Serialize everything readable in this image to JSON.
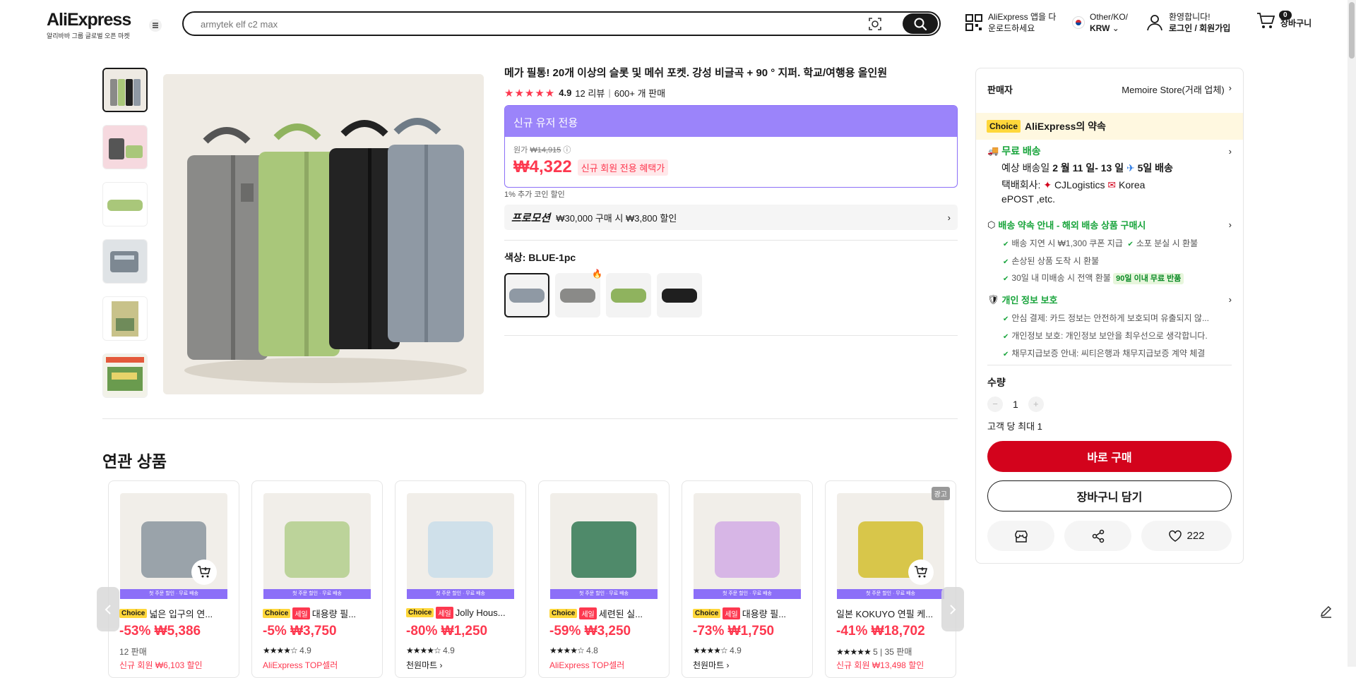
{
  "header": {
    "logo": "AliExpress",
    "logo_sub": "알리바바 그룹 글로벌 오픈 마켓",
    "search_placeholder": "armytek elf c2 max",
    "app_line1": "AliExpress 앱을 다",
    "app_line2": "운로드하세요",
    "locale_line1": "Other/KO/",
    "locale_line2": "KRW",
    "account_line1": "환영합니다!",
    "account_line2": "로그인 / 회원가입",
    "cart_count": "0",
    "cart_label": "장바구니"
  },
  "product": {
    "title": "메가 필통! 20개 이상의 슬롯 및 메쉬 포켓. 강성 비글곡 + 90 ° 지퍼. 학교/여행용 올인원",
    "rating": "4.9",
    "reviews": "12 리뷰",
    "sold": "600+ 개 판매",
    "new_user_header": "신규 유저 전용",
    "orig_label": "원가",
    "orig_price": "₩14,915",
    "price": "₩4,322",
    "price_tag": "신규 회원 전용 혜택가",
    "coin_note": "1% 추가 코인 할인",
    "promo_label": "프로모션",
    "promo_text": "₩30,000 구매 시 ₩3,800 할인",
    "color_label": "색상: BLUE-1pc",
    "swatch_colors": [
      "#8f99a4",
      "#8a8a88",
      "#8fb35e",
      "#1f1f1f"
    ]
  },
  "related": {
    "title": "연관 상품",
    "strip_text": "첫 주문 할인 · 무료 배송",
    "cards": [
      {
        "choice": "Choice",
        "sale": "",
        "title": "넓은 입구의 연...",
        "price": "-53% ₩5,386",
        "meta": "12 판매",
        "extra": "신규 회원 ₩6,103 할인",
        "stars": "",
        "rating": "",
        "img": "#9aa3aa",
        "cart": true,
        "ad": ""
      },
      {
        "choice": "Choice",
        "sale": "세일",
        "title": "대용량 필...",
        "price": "-5% ₩3,750",
        "meta": "",
        "extra": "AliExpress TOP셀러",
        "stars": "★★★★☆",
        "rating": "4.9",
        "img": "#bcd39a",
        "cart": false,
        "ad": ""
      },
      {
        "choice": "Choice",
        "sale": "세일",
        "title": "Jolly Hous...",
        "price": "-80% ₩1,250",
        "meta": "",
        "extra": "천원마트 ›",
        "stars": "★★★★☆",
        "rating": "4.9",
        "img": "#cfe0ea",
        "cart": false,
        "ad": ""
      },
      {
        "choice": "Choice",
        "sale": "세일",
        "title": "세련된 실...",
        "price": "-59% ₩3,250",
        "meta": "",
        "extra": "AliExpress TOP셀러",
        "stars": "★★★★☆",
        "rating": "4.8",
        "img": "#4f8a6a",
        "cart": false,
        "ad": ""
      },
      {
        "choice": "Choice",
        "sale": "세일",
        "title": "대용량 필...",
        "price": "-73% ₩1,750",
        "meta": "",
        "extra": "천원마트 ›",
        "stars": "★★★★☆",
        "rating": "4.9",
        "img": "#d7b6e6",
        "cart": false,
        "ad": ""
      },
      {
        "choice": "",
        "sale": "",
        "title": "일본 KOKUYO 연필 케...",
        "price": "-41% ₩18,702",
        "meta": "5 | 35 판매",
        "extra": "신규 회원 ₩13,498 할인",
        "stars": "★★★★★",
        "rating": "",
        "img": "#d8c64a",
        "cart": true,
        "ad": "광고"
      }
    ]
  },
  "panel": {
    "seller_label": "판매자",
    "seller_name": "Memoire Store(거래 업체)",
    "choice_badge": "Choice",
    "promise": "AliExpress의 약속",
    "free_ship": "무료 배송",
    "eta_prefix": "예상 배송일",
    "eta_dates": "2 월 11 일- 13 일",
    "eta_days": "5일 배송",
    "carrier_label": "택배회사:",
    "carrier1": "CJLogistics",
    "carrier2": "Korea",
    "carrier3": "ePOST ,etc.",
    "guide": "배송 약속 안내 - 해외 배송 상품 구매시",
    "g1": "배송 지연 시 ₩1,300 쿠폰 지급",
    "g2": "소포 분실 시 환불",
    "g3": "손상된 상품 도착 시 환불",
    "g4": "30일 내 미배송 시 전액 환불",
    "g4_badge": "90일 이내 무료 반품",
    "privacy": "개인 정보 보호",
    "p1": "안심 결제: 카드 정보는 안전하게 보호되며 유출되지 않...",
    "p2": "개인정보 보호: 개인정보 보안을 최우선으로 생각합니다.",
    "p3": "채무지급보증 안내: 씨티은행과 채무지급보증 계약 체결",
    "qty_label": "수량",
    "qty": "1",
    "limit": "고객 당 최대 1",
    "buy_now": "바로 구매",
    "add_cart": "장바구니 담기",
    "likes": "222"
  }
}
